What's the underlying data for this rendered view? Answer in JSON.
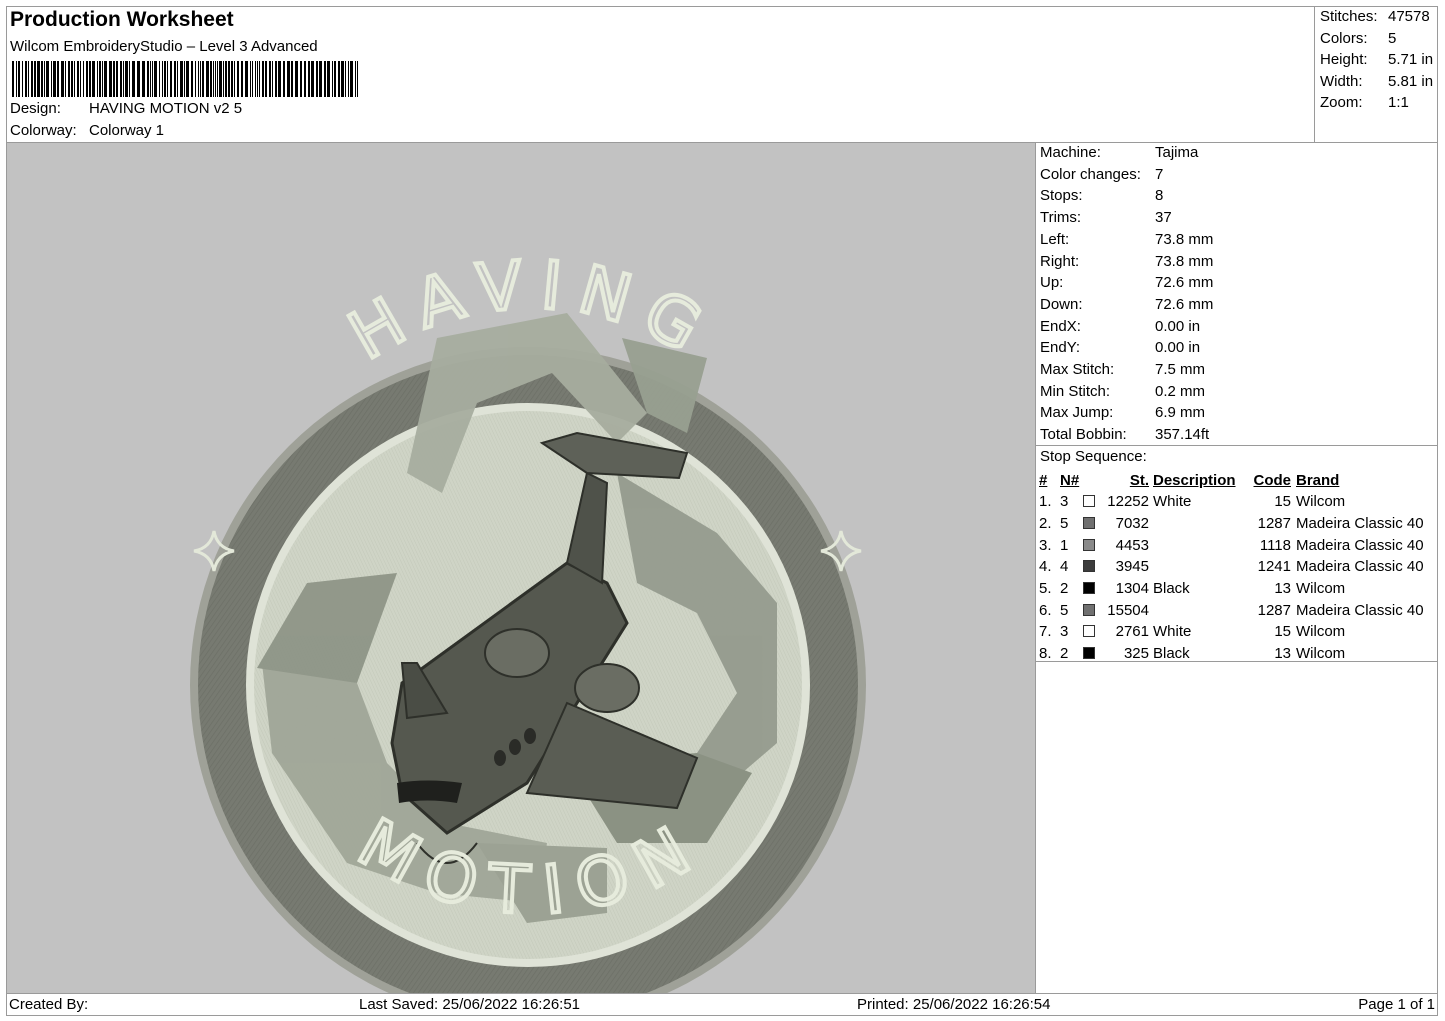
{
  "header": {
    "title": "Production Worksheet",
    "software": "Wilcom EmbroideryStudio – Level 3 Advanced",
    "design_label": "Design:",
    "design_value": "HAVING MOTION v2 5",
    "colorway_label": "Colorway:",
    "colorway_value": "Colorway 1"
  },
  "stats": [
    {
      "label": "Stitches:",
      "value": "47578"
    },
    {
      "label": "Colors:",
      "value": "5"
    },
    {
      "label": "Height:",
      "value": "5.71 in"
    },
    {
      "label": "Width:",
      "value": "5.81 in"
    },
    {
      "label": "Zoom:",
      "value": "1:1"
    }
  ],
  "info": [
    {
      "label": "Machine:",
      "value": "Tajima"
    },
    {
      "label": "Color changes:",
      "value": "7"
    },
    {
      "label": "Stops:",
      "value": "8"
    },
    {
      "label": "Trims:",
      "value": "37"
    },
    {
      "label": "Left:",
      "value": "73.8 mm"
    },
    {
      "label": "Right:",
      "value": "73.8 mm"
    },
    {
      "label": "Up:",
      "value": "72.6 mm"
    },
    {
      "label": "Down:",
      "value": "72.6 mm"
    },
    {
      "label": "EndX:",
      "value": "0.00 in"
    },
    {
      "label": "EndY:",
      "value": "0.00 in"
    },
    {
      "label": "Max Stitch:",
      "value": "7.5 mm"
    },
    {
      "label": "Min Stitch:",
      "value": "0.2 mm"
    },
    {
      "label": "Max Jump:",
      "value": "6.9 mm"
    },
    {
      "label": "Total Bobbin:",
      "value": "357.14ft"
    }
  ],
  "stop_sequence": {
    "title": "Stop Sequence:",
    "columns": [
      "#",
      "N#",
      "St.",
      "Description",
      "Code",
      "Brand"
    ],
    "rows": [
      {
        "idx": "1.",
        "n": "3",
        "color": "#ffffff",
        "st": "12252",
        "desc": "White",
        "code": "15",
        "brand": "Wilcom"
      },
      {
        "idx": "2.",
        "n": "5",
        "color": "#707070",
        "st": "7032",
        "desc": "",
        "code": "1287",
        "brand": "Madeira Classic 40"
      },
      {
        "idx": "3.",
        "n": "1",
        "color": "#8a8a8a",
        "st": "4453",
        "desc": "",
        "code": "1118",
        "brand": "Madeira Classic 40"
      },
      {
        "idx": "4.",
        "n": "4",
        "color": "#3c3c3c",
        "st": "3945",
        "desc": "",
        "code": "1241",
        "brand": "Madeira Classic 40"
      },
      {
        "idx": "5.",
        "n": "2",
        "color": "#000000",
        "st": "1304",
        "desc": "Black",
        "code": "13",
        "brand": "Wilcom"
      },
      {
        "idx": "6.",
        "n": "5",
        "color": "#707070",
        "st": "15504",
        "desc": "",
        "code": "1287",
        "brand": "Madeira Classic 40"
      },
      {
        "idx": "7.",
        "n": "3",
        "color": "#ffffff",
        "st": "2761",
        "desc": "White",
        "code": "15",
        "brand": "Wilcom"
      },
      {
        "idx": "8.",
        "n": "2",
        "color": "#000000",
        "st": "325",
        "desc": "Black",
        "code": "13",
        "brand": "Wilcom"
      }
    ]
  },
  "design_image": {
    "top_text": "HAVING",
    "bottom_text": "MOTION",
    "background_color": "#c2c2c2",
    "ring_color": "#777a71",
    "inner_color": "#cfd4c6",
    "arrow_color": "#959b8e",
    "plane_color": "#55584f"
  },
  "footer": {
    "created_by": "Created By:",
    "last_saved": "Last Saved: 25/06/2022 16:26:51",
    "printed": "Printed: 25/06/2022 16:26:54",
    "page": "Page 1 of 1"
  }
}
